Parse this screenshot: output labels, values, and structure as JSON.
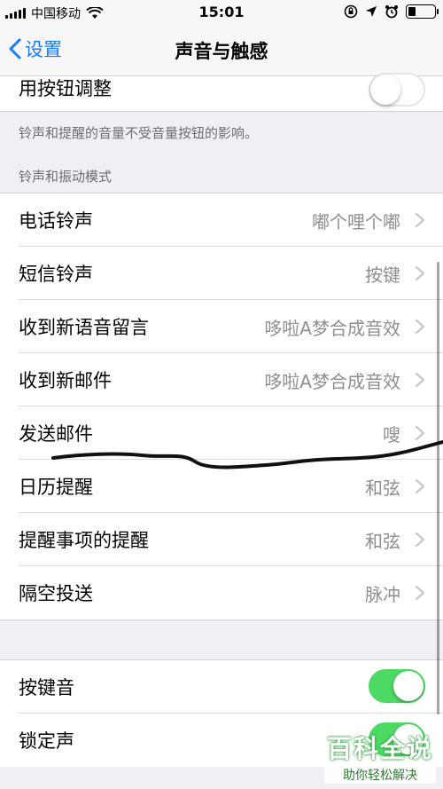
{
  "status_bar": {
    "carrier": "中国移动",
    "time": "15:01"
  },
  "nav": {
    "back_label": "设置",
    "title": "声音与触感"
  },
  "top_group": {
    "label": "用按钮调整",
    "toggle_on": false,
    "footer": "铃声和提醒的音量不受音量按钮的影响。"
  },
  "sounds_section": {
    "header": "铃声和振动模式",
    "items": [
      {
        "label": "电话铃声",
        "value": "嘟个哩个嘟"
      },
      {
        "label": "短信铃声",
        "value": "按键"
      },
      {
        "label": "收到新语音留言",
        "value": "哆啦A梦合成音效"
      },
      {
        "label": "收到新邮件",
        "value": "哆啦A梦合成音效"
      },
      {
        "label": "发送邮件",
        "value": "嗖"
      },
      {
        "label": "日历提醒",
        "value": "和弦"
      },
      {
        "label": "提醒事项的提醒",
        "value": "和弦"
      },
      {
        "label": "隔空投送",
        "value": "脉冲"
      }
    ]
  },
  "toggle_section": {
    "items": [
      {
        "label": "按键音",
        "on": true
      },
      {
        "label": "锁定声",
        "on": true
      }
    ]
  },
  "watermark": {
    "title": "百科全说",
    "subtitle": "助你轻松解决"
  },
  "colors": {
    "accent": "#157efb",
    "toggle_on": "#4cd964",
    "background": "#efeff4"
  }
}
